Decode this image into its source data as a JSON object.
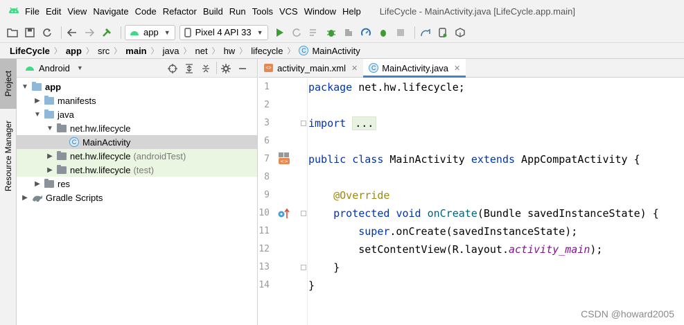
{
  "menubar": {
    "logo_icon": "android-studio-logo-icon",
    "items": [
      "File",
      "Edit",
      "View",
      "Navigate",
      "Code",
      "Refactor",
      "Build",
      "Run",
      "Tools",
      "VCS",
      "Window",
      "Help"
    ],
    "window_title": "LifeCycle - MainActivity.java [LifeCycle.app.main]"
  },
  "toolbar": {
    "run_config": "app",
    "device": "Pixel 4 API 33",
    "icons": [
      "open-folder-icon",
      "save-icon",
      "sync-icon",
      "back-icon",
      "forward-icon",
      "build-hammer-icon",
      "run-icon",
      "apply-changes-icon",
      "apply-code-changes-icon",
      "debug-icon",
      "profile-icon",
      "attach-debugger-icon",
      "stop-icon",
      "sync-gradle-icon",
      "device-manager-icon",
      "sdk-manager-icon"
    ]
  },
  "breadcrumb": [
    "LifeCycle",
    "app",
    "src",
    "main",
    "java",
    "net",
    "hw",
    "lifecycle",
    "MainActivity"
  ],
  "tool_stripe": {
    "project": "Project",
    "resource_manager": "Resource Manager"
  },
  "project_panel": {
    "view_mode": "Android",
    "tree": [
      {
        "label": "app",
        "suffix": "",
        "depth": 0,
        "expanded": true,
        "icon": "module-folder-icon",
        "bold": true
      },
      {
        "label": "manifests",
        "suffix": "",
        "depth": 1,
        "expanded": false,
        "icon": "folder-icon"
      },
      {
        "label": "java",
        "suffix": "",
        "depth": 1,
        "expanded": true,
        "icon": "folder-icon"
      },
      {
        "label": "net.hw.lifecycle",
        "suffix": "",
        "depth": 2,
        "expanded": true,
        "icon": "package-icon"
      },
      {
        "label": "MainActivity",
        "suffix": "",
        "depth": 3,
        "expanded": null,
        "icon": "class-icon",
        "selected": true
      },
      {
        "label": "net.hw.lifecycle",
        "suffix": "(androidTest)",
        "depth": 2,
        "expanded": false,
        "icon": "package-icon",
        "test": true
      },
      {
        "label": "net.hw.lifecycle",
        "suffix": "(test)",
        "depth": 2,
        "expanded": false,
        "icon": "package-icon",
        "test": true
      },
      {
        "label": "res",
        "suffix": "",
        "depth": 1,
        "expanded": false,
        "icon": "res-folder-icon"
      },
      {
        "label": "Gradle Scripts",
        "suffix": "",
        "depth": 0,
        "expanded": false,
        "icon": "gradle-icon"
      }
    ]
  },
  "editor": {
    "tabs": [
      {
        "label": "activity_main.xml",
        "active": false,
        "icon": "xml-file-icon"
      },
      {
        "label": "MainActivity.java",
        "active": true,
        "icon": "class-icon"
      }
    ],
    "line_numbers": [
      "1",
      "2",
      "3",
      "6",
      "7",
      "8",
      "9",
      "10",
      "11",
      "12",
      "13",
      "14"
    ],
    "code": {
      "l1_kw": "package",
      "l1_rest": " net.hw.lifecycle;",
      "l3_kw": "import",
      "l3_folded": "...",
      "l7_kw1": "public",
      "l7_kw2": "class",
      "l7_name": " MainActivity ",
      "l7_kw3": "extends",
      "l7_rest": " AppCompatActivity {",
      "l9_ann": "@Override",
      "l10_kw1": "protected",
      "l10_kw2": "void",
      "l10_fn": "onCreate",
      "l10_rest": "(Bundle savedInstanceState) {",
      "l11_kw": "super",
      "l11_rest": ".onCreate(savedInstanceState);",
      "l12_a": "setContentView(R.layout.",
      "l12_fld": "activity_main",
      "l12_b": ");",
      "l13": "}",
      "l14": "}"
    }
  },
  "watermark": "CSDN @howard2005",
  "colors": {
    "keyword": "#0033b3",
    "annotation": "#9e880d",
    "method": "#00627a",
    "field": "#871094",
    "selection": "#d5d5d5",
    "test_bg": "#eaf5e2",
    "tab_underline": "#4083c9"
  }
}
